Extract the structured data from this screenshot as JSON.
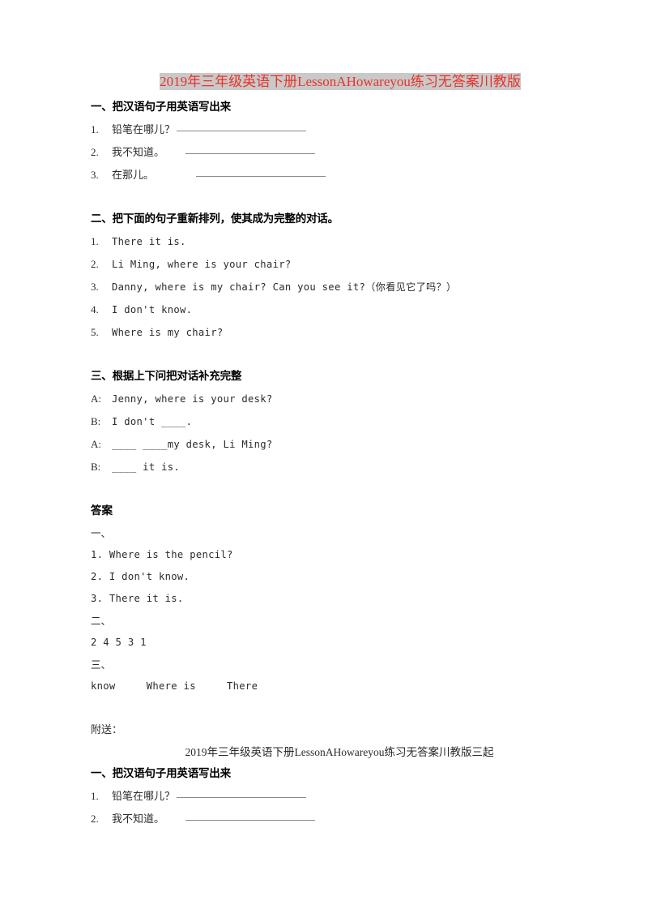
{
  "document": {
    "title_parts": [
      {
        "text": "2019",
        "script": "latin"
      },
      {
        "text": "年三年级英语下册",
        "script": "cjk"
      },
      {
        "text": "LessonAHowareyou",
        "script": "latin"
      },
      {
        "text": "练习无答案川教版",
        "script": "cjk"
      }
    ],
    "title_plain": "2019年三年级英语下册LessonAHowareyou练习无答案川教版",
    "title_color": "#e8332a",
    "title_highlight_color": "#c9c9c9"
  },
  "sections": [
    {
      "heading": "一、把汉语句子用英语写出来",
      "items": [
        {
          "num": "1.",
          "text": "铅笔在哪儿？",
          "blank_width": 160,
          "pre_gap": 2
        },
        {
          "num": "2.",
          "text": "我不知道。",
          "blank_width": 160,
          "pre_gap": 26
        },
        {
          "num": "3.",
          "text": "在那儿。",
          "blank_width": 160,
          "pre_gap": 52
        }
      ]
    },
    {
      "heading": "二、把下面的句子重新排列，使其成为完整的对话。",
      "items": [
        {
          "num": "1.",
          "text": "There it is."
        },
        {
          "num": "2.",
          "text": "Li Ming, where is your chair?"
        },
        {
          "num": "3.",
          "text": "Danny, where is my chair? Can you see it?（你看见它了吗？）"
        },
        {
          "num": "4.",
          "text": "I don't know."
        },
        {
          "num": "5.",
          "text": "Where is my chair?"
        }
      ]
    },
    {
      "heading": "三、根据上下问把对话补充完整",
      "dialogue": [
        {
          "speaker": "A:",
          "text": "Jenny, where is your desk?"
        },
        {
          "speaker": "B:",
          "text": "I don't ____."
        },
        {
          "speaker": "A:",
          "text": "____ ____my desk, Li Ming?"
        },
        {
          "speaker": "B:",
          "text": "____ it is."
        }
      ]
    }
  ],
  "answers": {
    "heading": "答案",
    "groups": [
      {
        "label": "一、",
        "lines": [
          "1. Where is the pencil?",
          "2. I don't know.",
          "3. There it is."
        ]
      },
      {
        "label": "二、",
        "lines": [
          "2 4 5 3 1"
        ]
      },
      {
        "label": "三、",
        "lines": [
          "know     Where is     There"
        ]
      }
    ]
  },
  "appendix": {
    "label": "附送：",
    "title_cjk_1": "年三年级英语下册",
    "title_num": "2019",
    "title_latin": "LessonAHowareyou",
    "title_cjk_2": "练习无答案川教版三起",
    "title_plain": "2019年三年级英语下册LessonAHowareyou练习无答案川教版三起",
    "heading": "一、把汉语句子用英语写出来",
    "items": [
      {
        "num": "1.",
        "text": "铅笔在哪儿？",
        "blank_width": 160,
        "pre_gap": 2
      },
      {
        "num": "2.",
        "text": "我不知道。",
        "blank_width": 160,
        "pre_gap": 26
      }
    ]
  }
}
